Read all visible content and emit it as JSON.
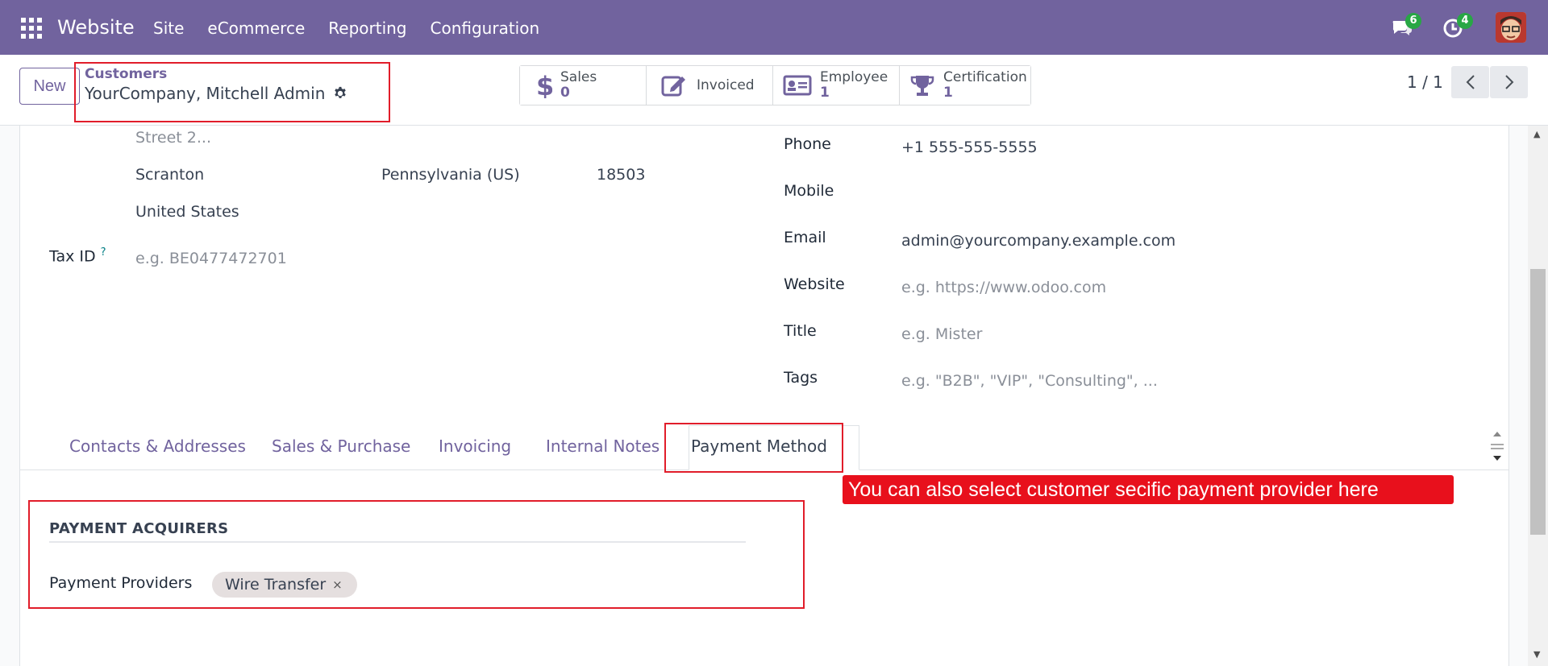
{
  "navbar": {
    "brand": "Website",
    "menu": [
      "Site",
      "eCommerce",
      "Reporting",
      "Configuration"
    ],
    "messages_badge": "6",
    "activities_badge": "4",
    "bg_color": "#71639e"
  },
  "control_panel": {
    "new_label": "New",
    "breadcrumb_parent": "Customers",
    "breadcrumb_current": "YourCompany, Mitchell Admin",
    "smart_buttons": [
      {
        "label": "Sales",
        "value": "0",
        "icon": "dollar-icon"
      },
      {
        "label": "Invoiced",
        "value": "",
        "icon": "edit-icon"
      },
      {
        "label": "Employee",
        "value": "1",
        "icon": "id-card-icon"
      },
      {
        "label": "Certification",
        "value": "1",
        "icon": "trophy-icon"
      }
    ],
    "pager": "1 / 1"
  },
  "address": {
    "street2_placeholder": "Street 2...",
    "city": "Scranton",
    "state": "Pennsylvania (US)",
    "zip": "18503",
    "country": "United States",
    "tax_id_label": "Tax ID",
    "tax_id_help": "?",
    "tax_id_placeholder": "e.g. BE0477472701"
  },
  "contact": {
    "phone_label": "Phone",
    "phone_value": "+1 555-555-5555",
    "mobile_label": "Mobile",
    "email_label": "Email",
    "email_value": "admin@yourcompany.example.com",
    "website_label": "Website",
    "website_placeholder": "e.g. https://www.odoo.com",
    "title_label": "Title",
    "title_placeholder": "e.g. Mister",
    "tags_label": "Tags",
    "tags_placeholder": "e.g. \"B2B\", \"VIP\", \"Consulting\", ..."
  },
  "tabs": [
    "Contacts & Addresses",
    "Sales & Purchase",
    "Invoicing",
    "Internal Notes",
    "Payment Method"
  ],
  "active_tab": "Payment Method",
  "payment": {
    "section_title": "PAYMENT ACQUIRERS",
    "providers_label": "Payment Providers",
    "providers": [
      "Wire Transfer"
    ],
    "remove_symbol": "×"
  },
  "callout_text": "You can also select customer secific payment provider here",
  "colors": {
    "accent": "#71639e",
    "annotation_red": "#e11d2a",
    "success": "#28a745"
  }
}
